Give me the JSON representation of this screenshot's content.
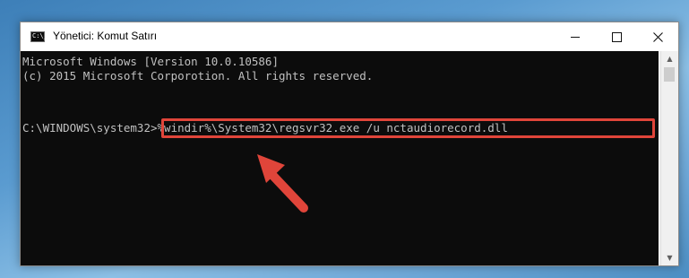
{
  "window": {
    "title": "Yönetici: Komut Satırı",
    "app_icon_text": "C:\\_"
  },
  "console": {
    "lines": [
      "Microsoft Windows [Version 10.0.10586]",
      "(c) 2015 Microsoft Corporotion. All rights reserved.",
      "",
      "C:\\WINDOWS\\system32>%windir%\\System32\\regsvr32.exe /u nctaudiorecord.dll"
    ]
  },
  "annotation": {
    "highlight_color": "#e0453a",
    "arrow_color": "#e0453a"
  },
  "icons": {
    "app": "cmd-icon",
    "minimize": "minimize-icon",
    "maximize": "maximize-icon",
    "close": "close-icon",
    "scroll_up": "chevron-up-icon",
    "scroll_down": "chevron-down-icon"
  }
}
